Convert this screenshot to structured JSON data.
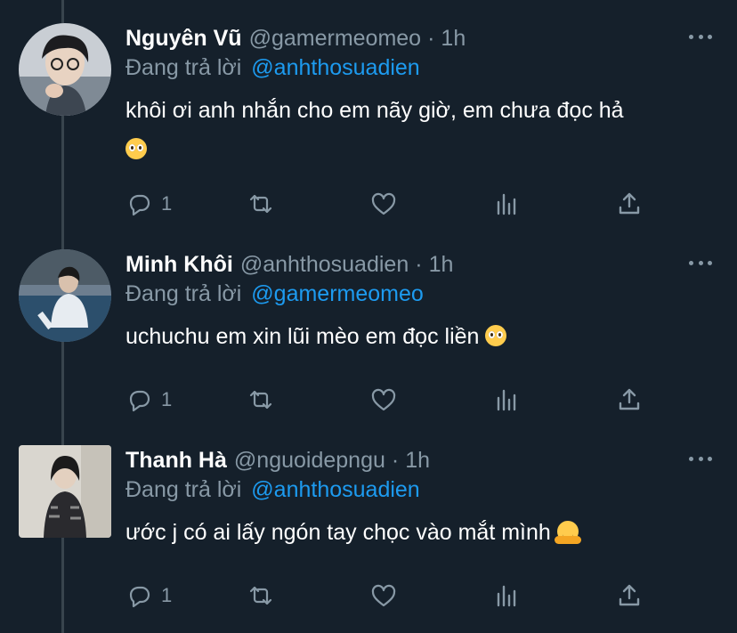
{
  "colors": {
    "background": "#15202b",
    "primary_text": "#ffffff",
    "secondary_text": "#8899a6",
    "mention": "#1d9bf0",
    "thread_line": "#38444d"
  },
  "tweets": [
    {
      "name": "Nguyên Vũ",
      "handle": "@gamermeomeo",
      "separator": "·",
      "time": "1h",
      "reply_prefix": "Đang trả lời",
      "reply_to": "@anhthosuadien",
      "text": "khôi ơi anh nhắn cho em nãy giờ, em chưa đọc hả",
      "emoji": "pleading-face",
      "reply_count": "1",
      "icons": [
        "reply-icon",
        "retweet-icon",
        "like-icon",
        "analytics-icon",
        "share-icon",
        "more-icon"
      ]
    },
    {
      "name": "Minh Khôi",
      "handle": "@anhthosuadien",
      "separator": "·",
      "time": "1h",
      "reply_prefix": "Đang trả lời",
      "reply_to": "@gamermeomeo",
      "text": "uchuchu em xin lũi mèo em đọc liền",
      "emoji": "pleading-face",
      "reply_count": "1",
      "icons": [
        "reply-icon",
        "retweet-icon",
        "like-icon",
        "analytics-icon",
        "share-icon",
        "more-icon"
      ]
    },
    {
      "name": "Thanh Hà",
      "handle": "@nguoidepngu",
      "separator": "·",
      "time": "1h",
      "reply_prefix": "Đang trả lời",
      "reply_to": "@anhthosuadien",
      "text": "ước j có ai lấy ngón tay chọc vào mắt mình",
      "emoji": "hugging-face",
      "reply_count": "1",
      "icons": [
        "reply-icon",
        "retweet-icon",
        "like-icon",
        "analytics-icon",
        "share-icon",
        "more-icon"
      ]
    }
  ]
}
